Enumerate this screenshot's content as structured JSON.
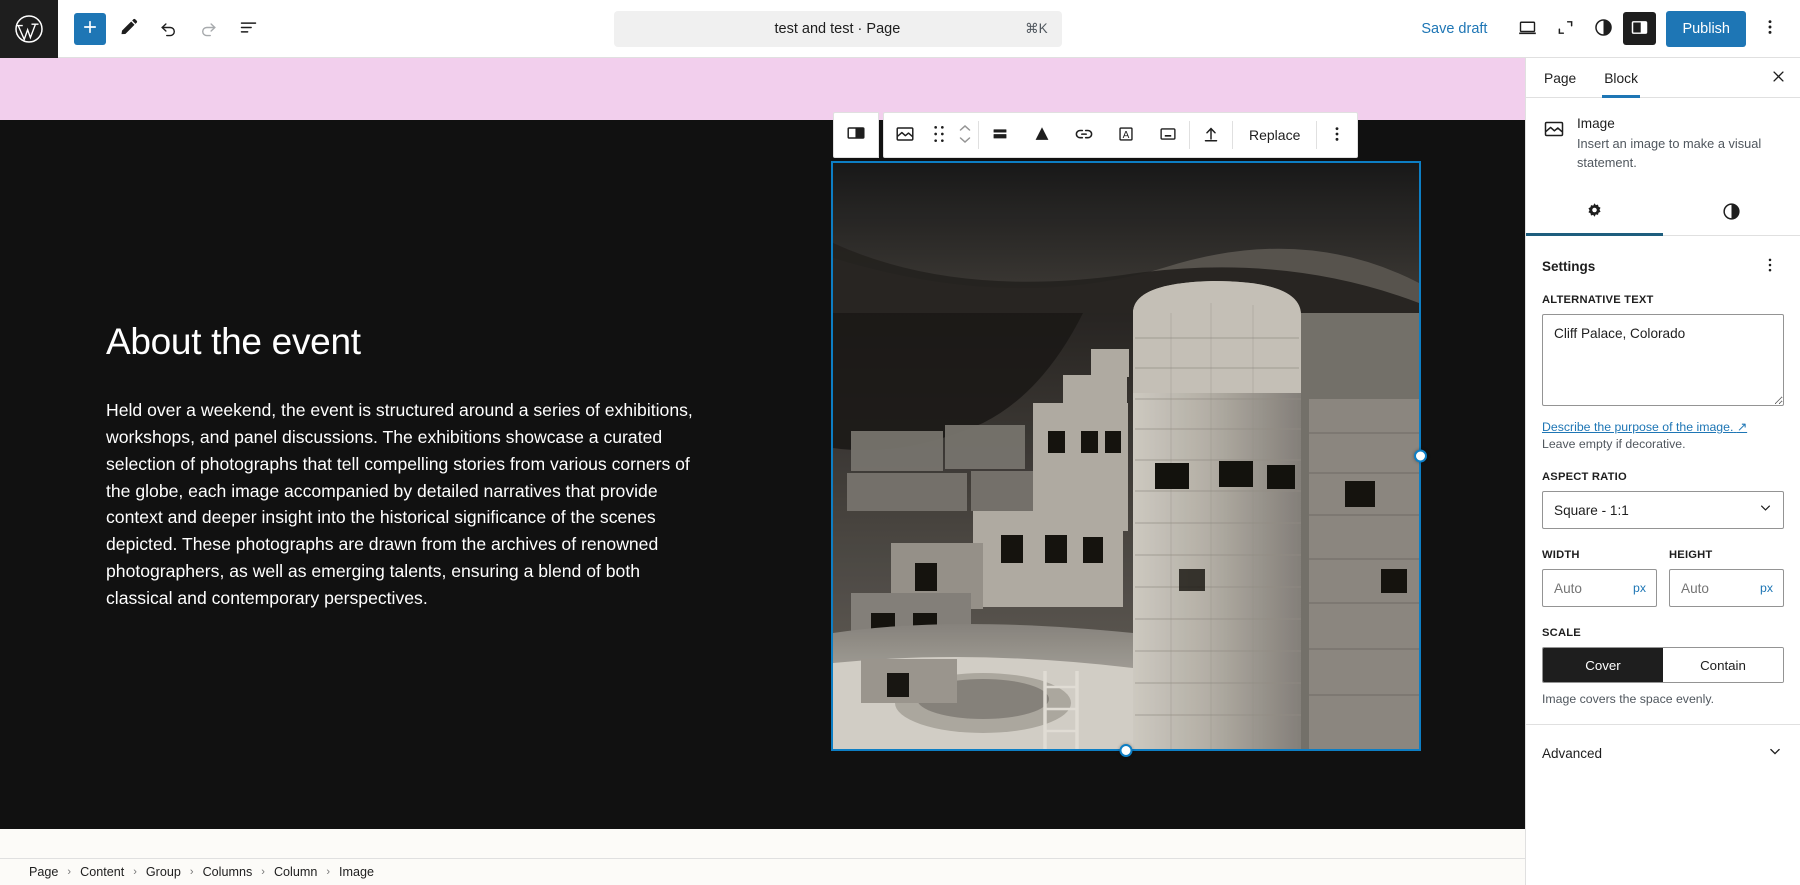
{
  "header": {
    "logo_icon": "wordpress-logo-icon",
    "left_tools": [
      {
        "name": "block-inserter-button",
        "label": "Add block",
        "icon": "plus-icon"
      },
      {
        "name": "tools-button",
        "label": "Tools",
        "icon": "pencil-icon"
      },
      {
        "name": "undo-button",
        "label": "Undo",
        "icon": "undo-arrow-icon"
      },
      {
        "name": "redo-button",
        "label": "Redo",
        "icon": "redo-arrow-icon"
      },
      {
        "name": "document-overview-button",
        "label": "Document Overview",
        "icon": "list-view-icon"
      }
    ],
    "command_bar": {
      "title": "test and test · Page",
      "shortcut": "⌘K"
    },
    "save_draft_label": "Save draft",
    "right_tools": [
      {
        "name": "view-desktop-button",
        "label": "View",
        "icon": "desktop-icon"
      },
      {
        "name": "zoom-out-button",
        "label": "Zoom out",
        "icon": "expand-corners-icon"
      },
      {
        "name": "styles-button",
        "label": "Styles",
        "icon": "contrast-circle-icon"
      },
      {
        "name": "settings-sidebar-button",
        "label": "Settings",
        "icon": "sidebar-panel-icon"
      }
    ],
    "publish_label": "Publish",
    "options_icon": "kebab-menu-icon",
    "accent_color": "#1e76b5",
    "dark_color": "#1e1e1e"
  },
  "block_toolbar": {
    "parent_block_button": {
      "name": "select-parent-columns-button",
      "icon": "columns-block-icon"
    },
    "buttons": [
      {
        "name": "block-type-image-button",
        "icon": "image-block-icon"
      },
      {
        "name": "drag-handle",
        "icon": "drag-dots-icon"
      },
      {
        "name": "move-updown-button",
        "icon": "chevron-updown-icon"
      },
      {
        "name": "align-button",
        "icon": "align-icon"
      },
      {
        "name": "crop-button",
        "icon": "crop-filter-icon"
      },
      {
        "name": "link-button",
        "icon": "link-icon"
      },
      {
        "name": "add-text-over-image-button",
        "icon": "text-box-icon"
      },
      {
        "name": "caption-button",
        "icon": "caption-icon"
      },
      {
        "name": "upload-button",
        "icon": "upload-icon"
      }
    ],
    "replace_label": "Replace",
    "options_icon": "kebab-menu-icon"
  },
  "canvas": {
    "band_color": "#f2cfed",
    "dark_color": "#111111",
    "content": {
      "heading": "About the event",
      "paragraph": "Held over a weekend, the event is structured around a series of exhibitions, workshops, and panel discussions. The exhibitions showcase a curated selection of photographs that tell compelling stories from various corners of the globe, each image accompanied by detailed narratives that provide context and deeper insight into the historical significance of the scenes depicted. These photographs are drawn from the archives of renowned photographers, as well as emerging talents, ensuring a blend of both classical and contemporary perspectives."
    },
    "image_block": {
      "name": "selected-image-block",
      "alt": "Cliff Palace, Colorado",
      "selection_color": "#0d7ec4",
      "handles": [
        "right-resize-handle",
        "bottom-resize-handle"
      ]
    }
  },
  "sidebar": {
    "tabs": [
      {
        "name": "tab-page",
        "label": "Page",
        "active": false
      },
      {
        "name": "tab-block",
        "label": "Block",
        "active": true
      }
    ],
    "close_icon": "close-icon",
    "block_info": {
      "icon": "image-block-icon",
      "title": "Image",
      "description": "Insert an image to make a visual statement."
    },
    "icon_tabs": [
      {
        "name": "tab-settings-icon",
        "icon": "gear-icon",
        "active": true
      },
      {
        "name": "tab-styles-icon",
        "icon": "contrast-circle-icon",
        "active": false
      }
    ],
    "settings": {
      "title": "Settings",
      "options_icon": "kebab-menu-icon",
      "alt_text": {
        "label": "ALTERNATIVE TEXT",
        "value": "Cliff Palace, Colorado",
        "placeholder": ""
      },
      "help_link": "Describe the purpose of the image.",
      "help_link_icon": "external-link-arrow-icon",
      "help_text": "Leave empty if decorative.",
      "aspect_ratio": {
        "label": "ASPECT RATIO",
        "value": "Square - 1:1",
        "chevron_icon": "chevron-down-icon"
      },
      "width": {
        "label": "WIDTH",
        "value": "",
        "placeholder": "Auto",
        "unit": "px"
      },
      "height": {
        "label": "HEIGHT",
        "value": "",
        "placeholder": "Auto",
        "unit": "px"
      },
      "scale": {
        "label": "SCALE",
        "options": [
          {
            "name": "scale-cover-button",
            "label": "Cover",
            "active": true
          },
          {
            "name": "scale-contain-button",
            "label": "Contain",
            "active": false
          }
        ],
        "help_text": "Image covers the space evenly."
      },
      "advanced": {
        "label": "Advanced",
        "chevron_icon": "chevron-down-icon"
      }
    }
  },
  "breadcrumb": {
    "separator": "›",
    "items": [
      {
        "name": "breadcrumb-item-page",
        "label": "Page"
      },
      {
        "name": "breadcrumb-item-content",
        "label": "Content"
      },
      {
        "name": "breadcrumb-item-group",
        "label": "Group"
      },
      {
        "name": "breadcrumb-item-columns",
        "label": "Columns"
      },
      {
        "name": "breadcrumb-item-column",
        "label": "Column"
      },
      {
        "name": "breadcrumb-item-image",
        "label": "Image"
      }
    ]
  }
}
